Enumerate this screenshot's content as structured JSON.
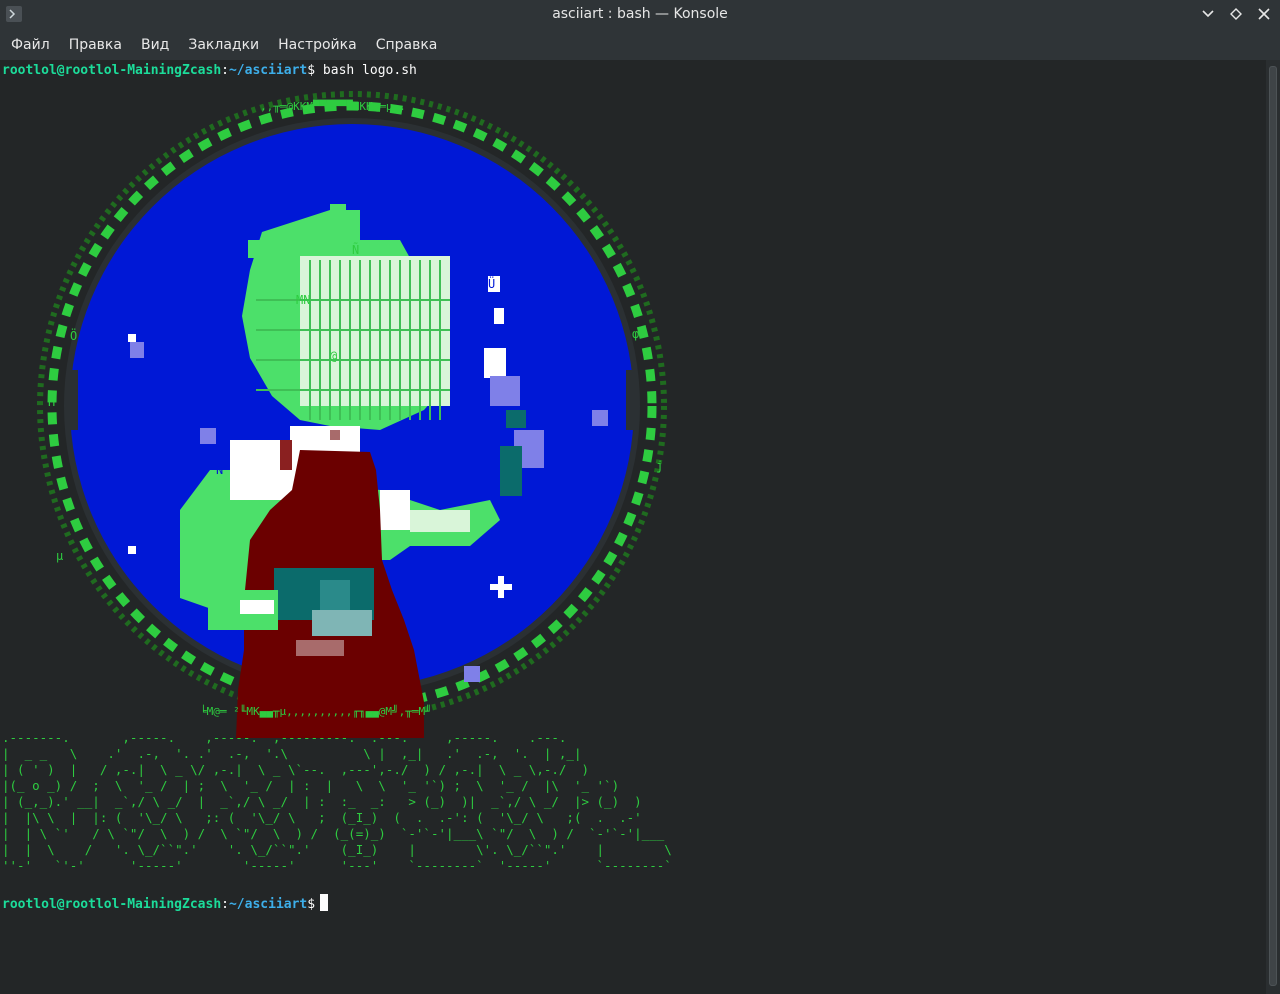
{
  "window": {
    "title": "asciiart : bash — Konsole"
  },
  "menu": [
    "Файл",
    "Правка",
    "Вид",
    "Закладки",
    "Настройка",
    "Справка"
  ],
  "prompt": {
    "user_host": "rootlol@rootlol-MainingZcash",
    "path": "~/asciiart",
    "symbol": "$"
  },
  "commands": {
    "first": "bash logo.sh"
  },
  "logo_text": {
    "top_arc": ",,╥═@KKM▀▀▀▀▀▀MKK@═µ,.",
    "bottom_arc": "╘M@═ ²╙MK▄▄╥µ,,,,,,,,,,╓╖▄▄@M╝,╥═M╜",
    "scattered": [
      "Ñ",
      "Ñ",
      "MN",
      "φ",
      "µ",
      "j",
      "H",
      "Ö",
      "Ü",
      "@"
    ]
  },
  "banner": [
    ".-------.       ,-----.    ,-----.  ,---------.  .---.     ,-----.    .---.",
    "|  _ _   \\    .'  .-,  '. .'  .-,  '.\\          \\ |  ,_|   .'  .-,  '.  | ,_|",
    "| ( ' )  |   / ,-.|  \\ _ \\/ ,-.|  \\ _ \\`--.  ,---',-./  ) / ,-.|  \\ _ \\,-./  )",
    "|(_ o _) /  ;  \\  '_ /  | ;  \\  '_ /  | :  |   \\  \\  '_ '`) ;  \\  '_ /  |\\  '_ '`)",
    "| (_,_).' __|  _`,/ \\ _/  |  _`,/ \\ _/  | :  :_  _:   > (_)  )|  _`,/ \\ _/  |> (_)  )",
    "|  |\\ \\  |  |: (  '\\_/ \\   ;: (  '\\_/ \\   ;  (_I_)  (  .  .-': (  '\\_/ \\   ;(  .  .-'",
    "|  | \\ `'   / \\ `\"/  \\  ) /  \\ `\"/  \\  ) /  (_(=)_)  `-'`-'|___\\ `\"/  \\  ) /  `-'`-'|___",
    "|  |  \\    /   '. \\_/``\".'    '. \\_/``\".'    (_I_)    |        \\'. \\_/``\".'    |        \\",
    "''-'   `'-'      '-----'        '-----'      '---'    `--------`  '-----'      `--------`"
  ]
}
